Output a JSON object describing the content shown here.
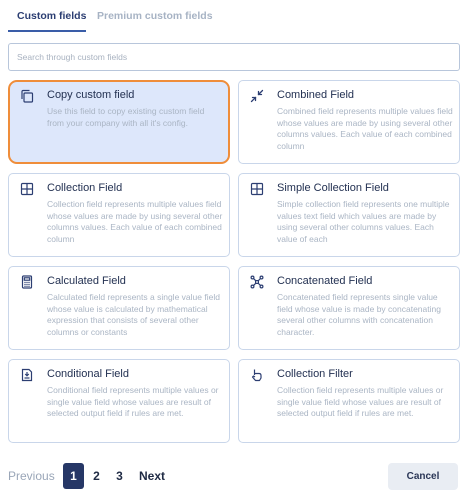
{
  "tabs": [
    {
      "label": "Custom fields",
      "active": true
    },
    {
      "label": "Premium custom fields",
      "active": false
    }
  ],
  "search": {
    "placeholder": "Search through custom fields",
    "value": ""
  },
  "cards": [
    {
      "title": "Copy custom field",
      "icon": "copy-icon",
      "selected": true,
      "description": "Use this field to copy existing custom field from your company with all it's config."
    },
    {
      "title": "Combined Field",
      "icon": "compress-arrows-icon",
      "selected": false,
      "description": "Combined field represents multiple values field whose values are made by using several other columns values. Each value of each combined column"
    },
    {
      "title": "Collection Field",
      "icon": "grid-icon",
      "selected": false,
      "description": "Collection field represents multiple values field whose values are made by using several other columns values. Each value of each combined column"
    },
    {
      "title": "Simple Collection Field",
      "icon": "grid-icon",
      "selected": false,
      "description": "Simple collection field represents one multiple values text field which values are made by using several other columns values. Each value of each"
    },
    {
      "title": "Calculated Field",
      "icon": "calculator-icon",
      "selected": false,
      "description": "Calculated field represents a single value field whose value is calculated by mathematical expression that consists of several other columns or constants"
    },
    {
      "title": "Concatenated Field",
      "icon": "nodes-icon",
      "selected": false,
      "description": "Concatenated field represents single value field whose value is made by concatenating several other columns with concatenation character."
    },
    {
      "title": "Conditional Field",
      "icon": "conditional-doc-icon",
      "selected": false,
      "description": "Conditional field represents multiple values or single value field whose values are result of selected output field if rules are met."
    },
    {
      "title": "Collection Filter",
      "icon": "filter-hand-icon",
      "selected": false,
      "description": "Collection field represents multiple values or single value field whose values are result of selected output field if rules are met."
    }
  ],
  "pagination": {
    "previous": "Previous",
    "pages": [
      "1",
      "2",
      "3"
    ],
    "current": "1",
    "next": "Next"
  },
  "cancel_label": "Cancel",
  "colors": {
    "accent": "#263766",
    "selected_border": "#ef8d3a",
    "selected_bg": "#dde7fb"
  }
}
